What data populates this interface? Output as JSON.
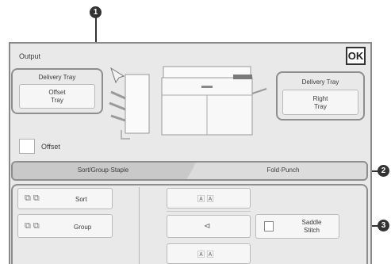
{
  "callouts": [
    "1",
    "2",
    "3"
  ],
  "header": {
    "title": "Output",
    "ok_label": "OK"
  },
  "left_tray": {
    "heading": "Delivery Tray",
    "value": "Offset\nTray"
  },
  "right_tray": {
    "heading": "Delivery Tray",
    "value": "Right\nTray"
  },
  "offset": {
    "label": "Offset",
    "checked": false
  },
  "tabs": [
    {
      "label": "Sort/Group·Staple",
      "active": true
    },
    {
      "label": "Fold·Punch",
      "active": false
    }
  ],
  "options": {
    "sort_label": "Sort",
    "group_label": "Group",
    "saddle_stitch_label": "Saddle\nStitch"
  }
}
